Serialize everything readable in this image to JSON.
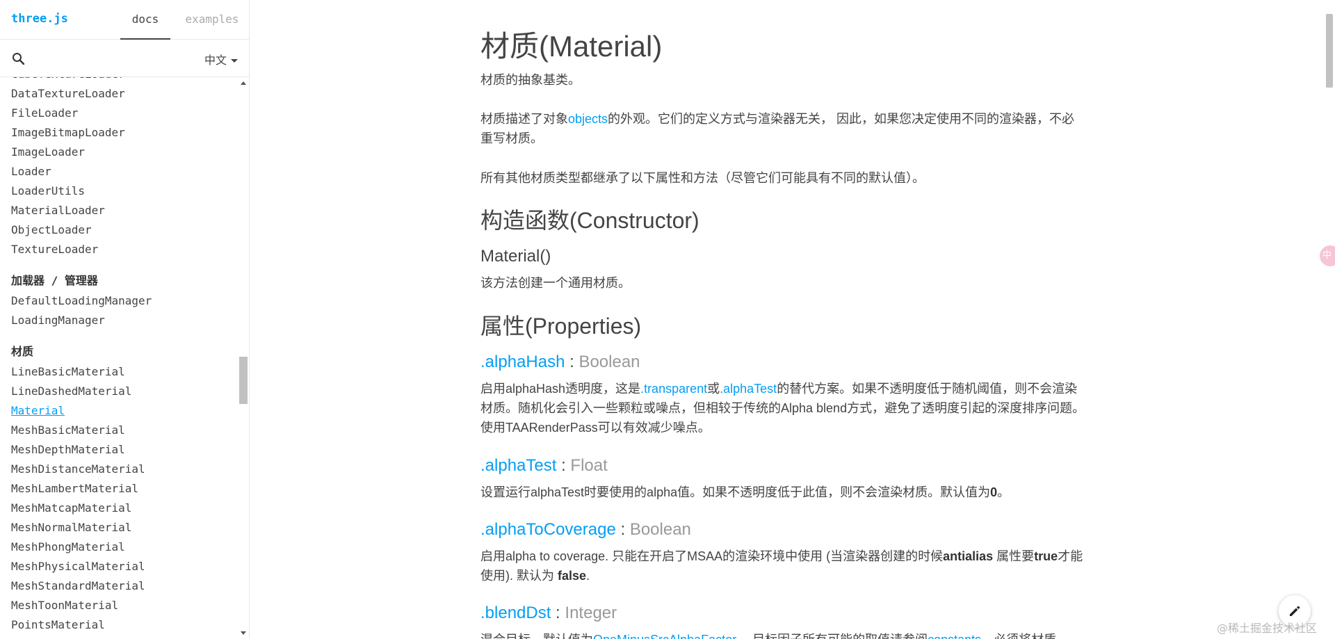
{
  "sidebar": {
    "logo": "three.js",
    "tabs": {
      "docs": "docs",
      "examples": "examples"
    },
    "language": "中文",
    "search_icon": "search-icon",
    "items_loaders": [
      "CubeTextureLoader",
      "DataTextureLoader",
      "FileLoader",
      "ImageBitmapLoader",
      "ImageLoader",
      "Loader",
      "LoaderUtils",
      "MaterialLoader",
      "ObjectLoader",
      "TextureLoader"
    ],
    "category_managers": "加载器 / 管理器",
    "items_managers": [
      "DefaultLoadingManager",
      "LoadingManager"
    ],
    "category_materials": "材质",
    "items_materials": [
      "LineBasicMaterial",
      "LineDashedMaterial",
      "Material",
      "MeshBasicMaterial",
      "MeshDepthMaterial",
      "MeshDistanceMaterial",
      "MeshLambertMaterial",
      "MeshMatcapMaterial",
      "MeshNormalMaterial",
      "MeshPhongMaterial",
      "MeshPhysicalMaterial",
      "MeshStandardMaterial",
      "MeshToonMaterial",
      "PointsMaterial"
    ],
    "selected_item": "Material"
  },
  "content": {
    "title": "材质(Material)",
    "intro": "材质的抽象基类。",
    "desc": {
      "before": "材质描述了对象",
      "link": "objects",
      "after": "的外观。它们的定义方式与渲染器无关， 因此，如果您决定使用不同的渲染器，不必重写材质。"
    },
    "inherit_note": "所有其他材质类型都继承了以下属性和方法（尽管它们可能具有不同的默认值）。",
    "constructor_heading": "构造函数(Constructor)",
    "constructor_sig": "Material()",
    "constructor_desc": "该方法创建一个通用材质。",
    "properties_heading": "属性(Properties)",
    "properties": {
      "alphaHash": {
        "name": ".alphaHash",
        "colon": " : ",
        "type": "Boolean",
        "d1": "启用alphaHash透明度，这是",
        "link1": ".transparent",
        "d2": "或",
        "link2": ".alphaTest",
        "d3": "的替代方案。如果不透明度低于随机阈值，则不会渲染材质。随机化会引入一些颗粒或噪点，但相较于传统的Alpha blend方式，避免了透明度引起的深度排序问题。使用TAARenderPass可以有效减少噪点。"
      },
      "alphaTest": {
        "name": ".alphaTest",
        "colon": " : ",
        "type": "Float",
        "d1": "设置运行alphaTest时要使用的alpha值。如果不透明度低于此值，则不会渲染材质。默认值为",
        "b1": "0",
        "d2": "。"
      },
      "alphaToCoverage": {
        "name": ".alphaToCoverage",
        "colon": " : ",
        "type": "Boolean",
        "d1": "启用alpha to coverage. 只能在开启了MSAA的渲染环境中使用 (当渲染器创建的时候",
        "b1": "antialias",
        "d2": " 属性要",
        "b2": "true",
        "d3": "才能使用). 默认为 ",
        "b3": "false",
        "d4": "."
      },
      "blendDst": {
        "name": ".blendDst",
        "colon": " : ",
        "type": "Integer",
        "d1": "混合目标。默认值为",
        "link1": "OneMinusSrcAlphaFactor",
        "d2": "。 目标因子所有可能的取值请参阅",
        "link2": "constants",
        "d3": "。必须将材质"
      }
    }
  },
  "widgets": {
    "translate_label": "中",
    "watermark": "@稀土掘金技术社区",
    "edit_icon": "pencil-icon"
  },
  "colors": {
    "accent": "#049ef4",
    "text": "#444444",
    "type_gray": "#999999"
  }
}
